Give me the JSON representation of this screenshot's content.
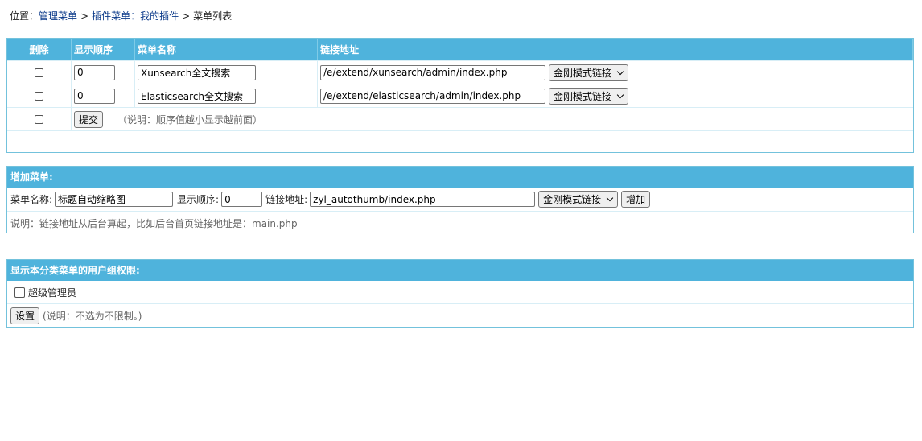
{
  "breadcrumb": {
    "prefix": "位置：",
    "link1": "管理菜单",
    "sep1": ">",
    "link2": "插件菜单：我的插件",
    "sep2": ">",
    "current": "菜单列表"
  },
  "menu_table": {
    "headers": [
      "删除",
      "显示顺序",
      "菜单名称",
      "链接地址"
    ],
    "rows": [
      {
        "order": "0",
        "name": "Xunsearch全文搜索",
        "url": "/e/extend/xunsearch/admin/index.php",
        "mode": "金刚模式链接"
      },
      {
        "order": "0",
        "name": "Elasticsearch全文搜索",
        "url": "/e/extend/elasticsearch/admin/index.php",
        "mode": "金刚模式链接"
      }
    ],
    "submit_label": "提交",
    "note": "（说明：顺序值越小显示越前面）"
  },
  "add_menu": {
    "title": "增加菜单:",
    "name_label": "菜单名称:",
    "name_value": "标题自动缩略图",
    "order_label": "显示顺序:",
    "order_value": "0",
    "url_label": "链接地址:",
    "url_value": "zyl_autothumb/index.php",
    "mode": "金刚模式链接",
    "add_label": "增加",
    "note": "说明：链接地址从后台算起，比如后台首页链接地址是：main.php"
  },
  "permissions": {
    "title": "显示本分类菜单的用户组权限:",
    "groups": [
      "超级管理员"
    ],
    "set_label": "设置",
    "note": "(说明：不选为不限制。)"
  }
}
